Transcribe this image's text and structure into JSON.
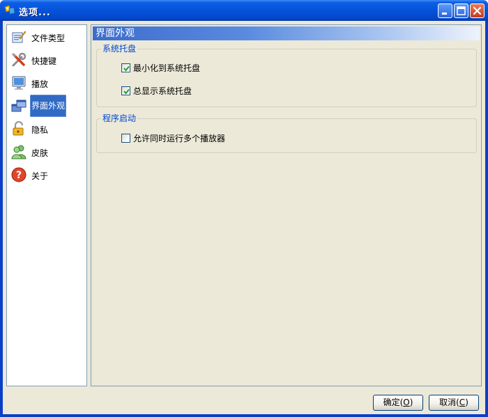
{
  "window": {
    "title": "选项...",
    "controls": [
      "minimize-icon",
      "maximize-icon",
      "close-icon"
    ]
  },
  "sidebar": {
    "items": [
      {
        "label": "文件类型",
        "icon": "file-types-icon",
        "selected": false
      },
      {
        "label": "快捷键",
        "icon": "shortcut-tools-icon",
        "selected": false
      },
      {
        "label": "播放",
        "icon": "monitor-icon",
        "selected": false
      },
      {
        "label": "界面外观",
        "icon": "windows-icon",
        "selected": true
      },
      {
        "label": "隐私",
        "icon": "padlock-icon",
        "selected": false
      },
      {
        "label": "皮肤",
        "icon": "users-icon",
        "selected": false
      },
      {
        "label": "关于",
        "icon": "help-icon",
        "selected": false
      }
    ]
  },
  "content": {
    "header": "界面外观",
    "groups": [
      {
        "title": "系统托盘",
        "options": [
          {
            "label": "最小化到系统托盘",
            "checked": true
          },
          {
            "label": "总显示系统托盘",
            "checked": true
          }
        ]
      },
      {
        "title": "程序启动",
        "options": [
          {
            "label": "允许同时运行多个播放器",
            "checked": false
          }
        ]
      }
    ]
  },
  "buttons": {
    "ok_prefix": "确定(",
    "ok_mnemonic": "O",
    "ok_suffix": ")",
    "cancel_prefix": "取消(",
    "cancel_mnemonic": "C",
    "cancel_suffix": ")"
  },
  "colors": {
    "titlebar": "#0553da",
    "selection": "#316ac5",
    "group_title": "#0046d5",
    "face": "#ece9d8"
  }
}
